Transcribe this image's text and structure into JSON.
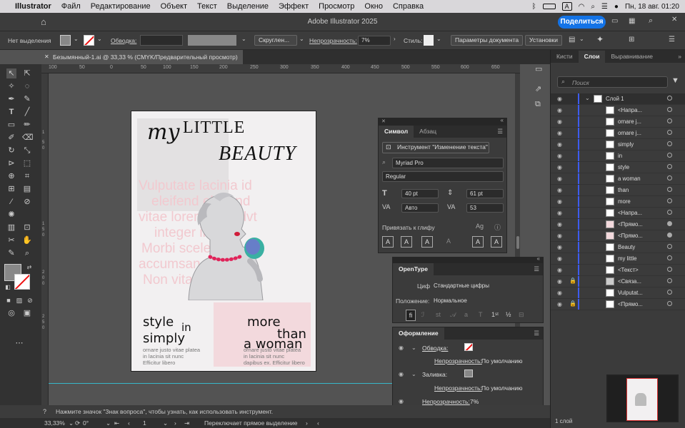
{
  "menubar": {
    "apple": "",
    "app": "Illustrator",
    "items": [
      "Файл",
      "Редактирование",
      "Объект",
      "Текст",
      "Выделение",
      "Эффект",
      "Просмотр",
      "Окно",
      "Справка"
    ],
    "input_source": "A",
    "clock": "Пн, 18 авг.  01:20"
  },
  "titlebar": {
    "title": "Adobe Illustrator 2025",
    "share": "Поделиться"
  },
  "control": {
    "selection": "Нет выделения",
    "stroke_label": "Обводка:",
    "brush": "Скруглен...",
    "opacity_label": "Непрозрачность:",
    "opacity_value": "7%",
    "style_label": "Стиль:",
    "doc_params": "Параметры документа",
    "prefs": "Установки"
  },
  "document_tab": {
    "title": "Безымянный-1.ai @ 33,33 % (CMYK/Предварительный просмотр)"
  },
  "ruler": {
    "top": [
      "100",
      "50",
      "0",
      "50",
      "100",
      "150",
      "200",
      "250",
      "300",
      "350",
      "400",
      "450",
      "500",
      "550",
      "600",
      "650"
    ],
    "left": [
      "1",
      "5",
      "0",
      "1",
      "5",
      "0",
      "2",
      "0",
      "0",
      "2",
      "5",
      "0"
    ]
  },
  "artboard": {
    "title_my": "my",
    "title_little": "LITTLE",
    "title_beauty": "BEAUTY",
    "watermark": [
      "Vulputate lacinia id",
      "eleifend eleifend",
      "vitae lorem amefdvt",
      "integer in ex",
      "Morbi scelerio",
      "accumsan fectum",
      "Non vitae morbi de"
    ],
    "left_big1": "style",
    "left_small": "in",
    "left_big2": "simply",
    "left_body": [
      "ornare justo vitae platea",
      "in lacinia sit nunc",
      "Efficitur libero"
    ],
    "right_big1": "more",
    "right_big2": "than",
    "right_big3": "a woman",
    "right_body": [
      "ornare justo vitae platea",
      "in lacinia sit nunc",
      "dapibus ex. Efficitur libero"
    ]
  },
  "char_panel": {
    "tab1": "Символ",
    "tab2": "Абзац",
    "tool_btn": "Инструмент \"Изменение текста\"",
    "font": "Myriad Pro",
    "style": "Regular",
    "size": "40 pt",
    "leading": "61 pt",
    "kerning": "Авто",
    "tracking": "53",
    "snap": "Привязать к глифу"
  },
  "opentype": {
    "tab": "OpenType",
    "digits_label": "Цифра:",
    "digits_value": "Стандартные цифры",
    "position_label": "Положение:",
    "position_value": "Нормальное"
  },
  "appearance": {
    "tab": "Оформление",
    "stroke": "Обводка:",
    "stroke_opacity": "Непрозрачность:",
    "stroke_opacity_value": "По умолчанию",
    "fill": "Заливка:",
    "fill_opacity": "Непрозрачность:",
    "fill_opacity_value": "По умолчанию",
    "opacity": "Непрозрачность:",
    "opacity_value": "7%"
  },
  "layers": {
    "tabs": [
      "Кисти",
      "Слои",
      "Выравнивание"
    ],
    "search_placeholder": "Поиск",
    "layer_name": "Слой 1",
    "rows": [
      "<Напра...",
      "ornare j...",
      "ornare j...",
      "simply",
      "in",
      "style",
      "a woman",
      "than",
      "more",
      "<Напра...",
      "<Прямо...",
      "<Прямо...",
      "Beauty",
      "my little",
      "<Текст>",
      "<Связа...",
      "Vulputat...",
      "<Прямо..."
    ],
    "footer": "1 слой"
  },
  "status": {
    "hint": "Нажмите значок \"Знак вопроса\", чтобы узнать, как использовать инструмент.",
    "zoom": "33,33%",
    "angle": "0°",
    "artboard": "1",
    "mode": "Переключает прямое выделение"
  },
  "colors": {
    "accent": "#1473e6",
    "layer_bar": "#3d5cf0",
    "watermark": "#f2c9cf"
  }
}
